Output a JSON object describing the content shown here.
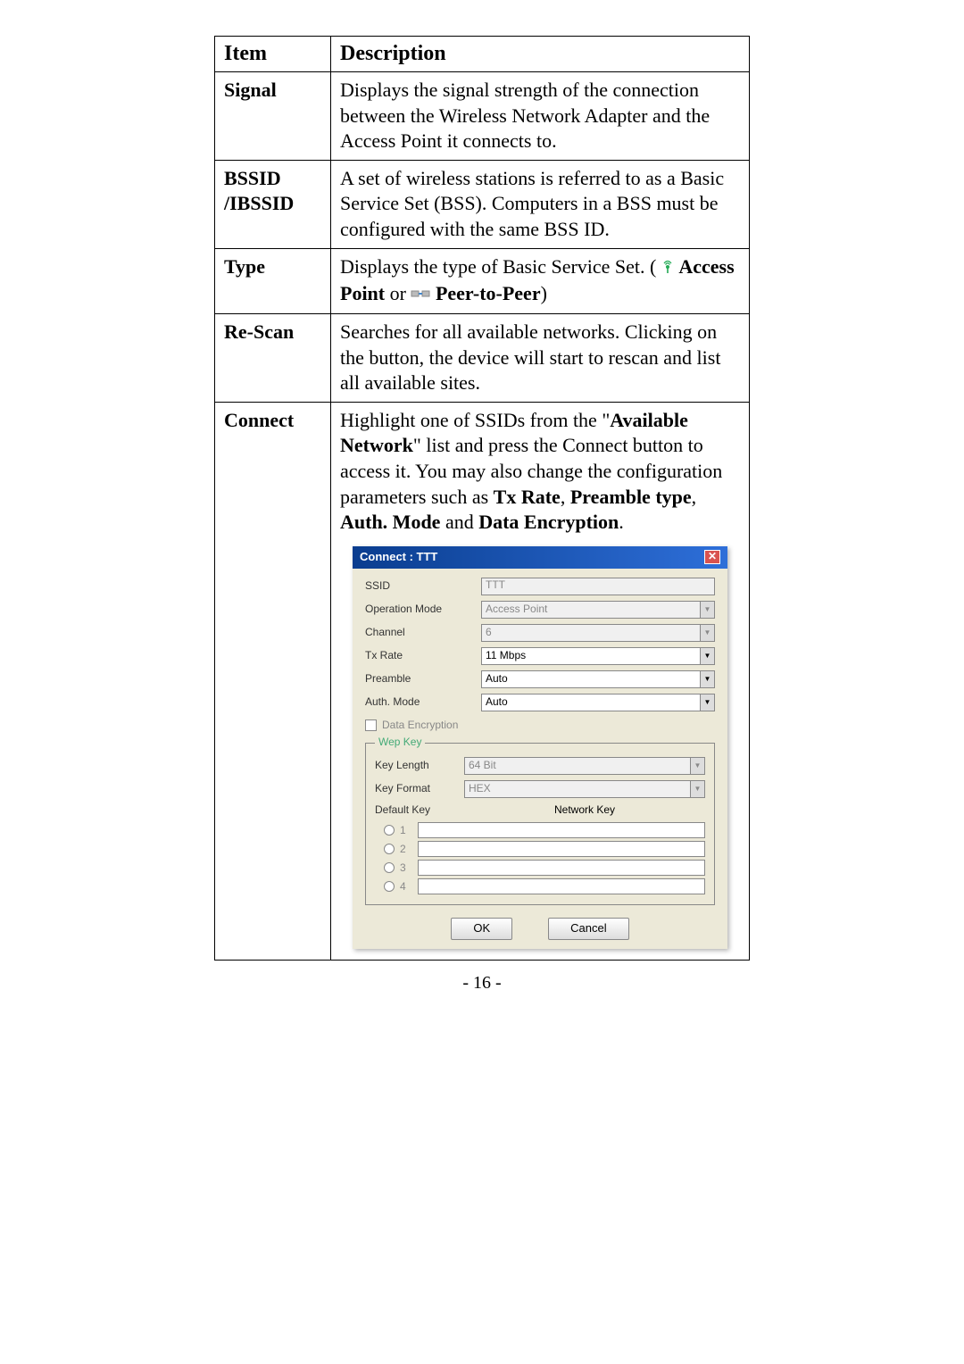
{
  "table": {
    "headers": {
      "item": "Item",
      "description": "Description"
    },
    "rows": [
      {
        "item": "Signal",
        "desc": "Displays the signal strength of the connection between the Wireless Network Adapter and the Access Point it connects to."
      },
      {
        "item": "BSSID /IBSSID",
        "desc": "A set of wireless stations is referred to as a Basic Service Set (BSS). Computers in a BSS must be configured with the same BSS ID."
      },
      {
        "item": "Type",
        "desc_prefix": "Displays the type of Basic Service Set. ( ",
        "ap_label": "Access Point",
        "or_text": " or  ",
        "p2p_label": "Peer-to-Peer",
        "desc_suffix": ")"
      },
      {
        "item": "Re-Scan",
        "desc": "Searches for all available networks. Clicking on the button, the device will start to rescan and list all available sites."
      },
      {
        "item": "Connect",
        "desc_p1": "Highlight one of SSIDs from the \"",
        "bold1": "Available Network",
        "desc_p2": "\" list and press the Connect button to access it. You may also change the configuration parameters such as ",
        "bold2": "Tx Rate",
        "desc_p3": ", ",
        "bold3": "Preamble type",
        "desc_p4": ", ",
        "bold4": "Auth. Mode",
        "desc_p5": " and ",
        "bold5": "Data Encryption",
        "desc_p6": "."
      }
    ]
  },
  "dialog": {
    "title": "Connect :   TTT",
    "fields": {
      "ssid_label": "SSID",
      "ssid_value": "TTT",
      "opmode_label": "Operation  Mode",
      "opmode_value": "Access Point",
      "channel_label": "Channel",
      "channel_value": "6",
      "txrate_label": "Tx Rate",
      "txrate_value": "11 Mbps",
      "preamble_label": "Preamble",
      "preamble_value": "Auto",
      "authmode_label": "Auth. Mode",
      "authmode_value": "Auto",
      "dataenc_label": "Data Encryption",
      "wep_legend": "Wep Key",
      "keylen_label": "Key Length",
      "keylen_value": "64 Bit",
      "keyfmt_label": "Key Format",
      "keyfmt_value": "HEX",
      "defkey_label": "Default Key",
      "netkey_label": "Network Key",
      "r1": "1",
      "r2": "2",
      "r3": "3",
      "r4": "4",
      "ok": "OK",
      "cancel": "Cancel"
    }
  },
  "page_number": "- 16 -"
}
